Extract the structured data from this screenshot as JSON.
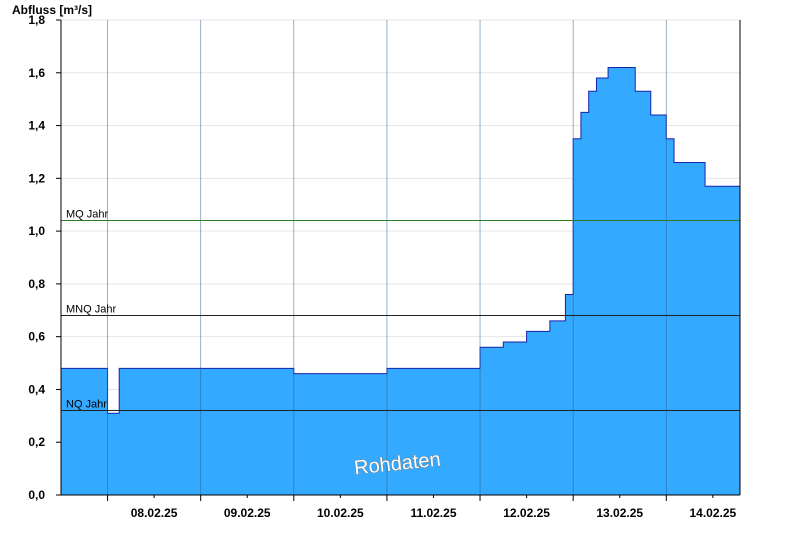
{
  "chart_data": {
    "type": "area",
    "ylabel": "Abfluss [m³/s]",
    "ylim": [
      0,
      1.8
    ],
    "yticks": [
      "0,0",
      "0,2",
      "0,4",
      "0,6",
      "0,8",
      "1,0",
      "1,2",
      "1,4",
      "1,6",
      "1,8"
    ],
    "xlim": [
      "07.02.25 12:00",
      "14.02.25 19:00"
    ],
    "xticks": [
      "08.02.25",
      "09.02.25",
      "10.02.25",
      "11.02.25",
      "12.02.25",
      "13.02.25",
      "14.02.25"
    ],
    "grid": true,
    "series": [
      {
        "x": [
          "07.02.25 12:00",
          "07.02.25 17:00",
          "07.02.25 22:00",
          "08.02.25 00:00",
          "08.02.25 03:00",
          "08.02.25 06:00",
          "08.02.25 12:00",
          "08.02.25 18:00",
          "09.02.25 00:00",
          "09.02.25 06:00",
          "09.02.25 12:00",
          "09.02.25 18:00",
          "10.02.25 00:00",
          "10.02.25 06:00",
          "10.02.25 12:00",
          "10.02.25 18:00",
          "11.02.25 00:00",
          "11.02.25 06:00",
          "11.02.25 12:00",
          "11.02.25 18:00",
          "12.02.25 00:00",
          "12.02.25 06:00",
          "12.02.25 12:00",
          "12.02.25 18:00",
          "12.02.25 22:00",
          "13.02.25 00:00",
          "13.02.25 02:00",
          "13.02.25 04:00",
          "13.02.25 06:00",
          "13.02.25 09:00",
          "13.02.25 12:00",
          "13.02.25 16:00",
          "13.02.25 20:00",
          "14.02.25 00:00",
          "14.02.25 02:00",
          "14.02.25 05:00",
          "14.02.25 10:00",
          "14.02.25 15:00",
          "14.02.25 19:00"
        ],
        "values": [
          0.48,
          0.48,
          0.48,
          0.31,
          0.48,
          0.48,
          0.48,
          0.48,
          0.48,
          0.48,
          0.48,
          0.48,
          0.46,
          0.46,
          0.46,
          0.46,
          0.48,
          0.48,
          0.48,
          0.48,
          0.56,
          0.58,
          0.62,
          0.66,
          0.76,
          1.35,
          1.45,
          1.53,
          1.58,
          1.62,
          1.62,
          1.53,
          1.44,
          1.35,
          1.26,
          1.26,
          1.17,
          1.17,
          1.09
        ],
        "color": "#33aaff"
      }
    ],
    "reference_lines": [
      {
        "label": "MQ Jahr",
        "value": 1.04,
        "color": "#2a7a2a"
      },
      {
        "label": "MNQ Jahr",
        "value": 0.68,
        "color": "#222222"
      },
      {
        "label": "NQ Jahr",
        "value": 0.32,
        "color": "#222222"
      }
    ],
    "watermark": "Rohdaten"
  }
}
